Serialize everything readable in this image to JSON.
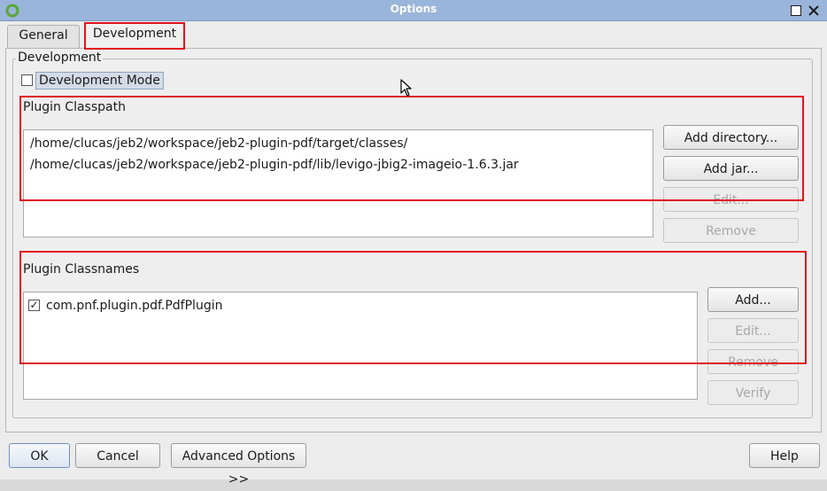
{
  "window": {
    "title": "Options",
    "accent_color": "#9ab5db",
    "highlight_color": "#e0141c"
  },
  "tabs": [
    {
      "label": "General",
      "selected": false
    },
    {
      "label": "Development",
      "selected": true
    }
  ],
  "development": {
    "group_title": "Development",
    "mode_checkbox": {
      "label": "Development Mode",
      "checked": false
    },
    "classpath": {
      "label": "Plugin Classpath",
      "items": [
        "/home/clucas/jeb2/workspace/jeb2-plugin-pdf/target/classes/",
        "/home/clucas/jeb2/workspace/jeb2-plugin-pdf/lib/levigo-jbig2-imageio-1.6.3.jar"
      ],
      "buttons": {
        "add_directory": "Add directory...",
        "add_jar": "Add jar...",
        "edit": "Edit...",
        "remove": "Remove"
      }
    },
    "classnames": {
      "label": "Plugin Classnames",
      "items": [
        {
          "name": "com.pnf.plugin.pdf.PdfPlugin",
          "checked": true
        }
      ],
      "buttons": {
        "add": "Add...",
        "edit": "Edit...",
        "remove": "Remove",
        "verify": "Verify"
      }
    }
  },
  "footer": {
    "ok": "OK",
    "cancel": "Cancel",
    "advanced": "Advanced Options >>",
    "help": "Help"
  }
}
